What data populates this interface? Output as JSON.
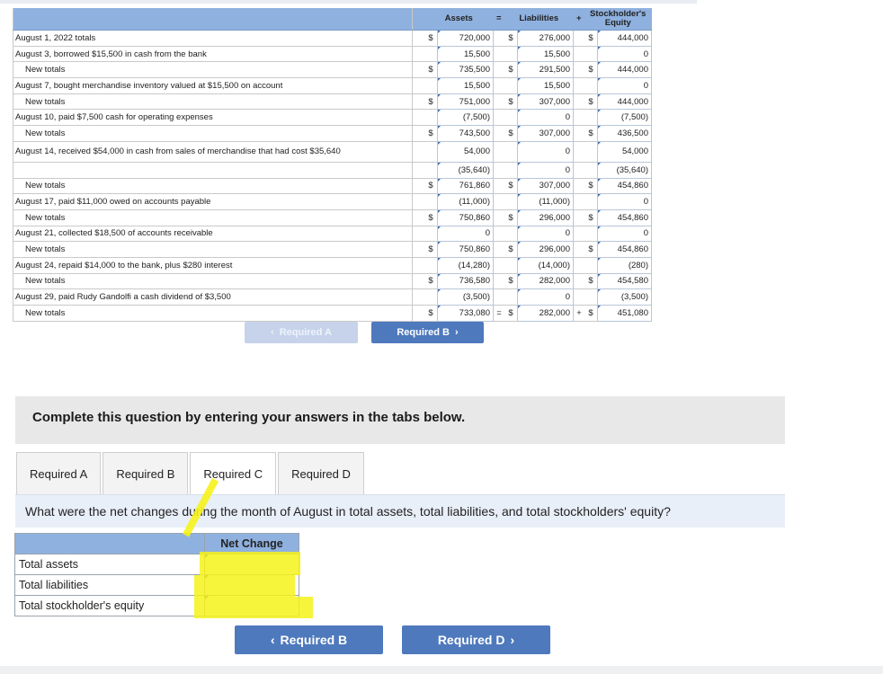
{
  "table": {
    "header": {
      "assets": "Assets",
      "eq": "=",
      "liabilities": "Liabilities",
      "plus": "+",
      "equity_line1": "Stockholder's",
      "equity_line2": "Equity"
    },
    "rows": [
      {
        "desc": "August 1, 2022 totals",
        "indent": false,
        "cur": true,
        "a": "720,000",
        "l": "276,000",
        "e": "444,000"
      },
      {
        "desc": "August 3, borrowed $15,500 in cash from the bank",
        "indent": false,
        "cur": false,
        "a": "15,500",
        "l": "15,500",
        "e": "0"
      },
      {
        "desc": "New totals",
        "indent": true,
        "cur": true,
        "a": "735,500",
        "l": "291,500",
        "e": "444,000"
      },
      {
        "desc": "August 7, bought merchandise inventory valued at $15,500 on account",
        "indent": false,
        "cur": false,
        "a": "15,500",
        "l": "15,500",
        "e": "0"
      },
      {
        "desc": "New totals",
        "indent": true,
        "cur": true,
        "a": "751,000",
        "l": "307,000",
        "e": "444,000"
      },
      {
        "desc": "August 10, paid $7,500 cash for operating expenses",
        "indent": false,
        "cur": false,
        "a": "(7,500)",
        "l": "0",
        "e": "(7,500)"
      },
      {
        "desc": "New totals",
        "indent": true,
        "cur": true,
        "a": "743,500",
        "l": "307,000",
        "e": "436,500"
      },
      {
        "desc": "August 14, received $54,000 in cash from sales of merchandise that had cost $35,640",
        "indent": false,
        "cur": false,
        "a": "54,000",
        "l": "0",
        "e": "54,000"
      },
      {
        "desc": "",
        "indent": false,
        "cur": false,
        "a": "(35,640)",
        "l": "0",
        "e": "(35,640)"
      },
      {
        "desc": "New totals",
        "indent": true,
        "cur": true,
        "a": "761,860",
        "l": "307,000",
        "e": "454,860"
      },
      {
        "desc": "August 17, paid $11,000 owed on accounts payable",
        "indent": false,
        "cur": false,
        "a": "(11,000)",
        "l": "(11,000)",
        "e": "0"
      },
      {
        "desc": "New totals",
        "indent": true,
        "cur": true,
        "a": "750,860",
        "l": "296,000",
        "e": "454,860"
      },
      {
        "desc": "August 21, collected $18,500 of accounts receivable",
        "indent": false,
        "cur": false,
        "a": "0",
        "l": "0",
        "e": "0"
      },
      {
        "desc": "New totals",
        "indent": true,
        "cur": true,
        "a": "750,860",
        "l": "296,000",
        "e": "454,860"
      },
      {
        "desc": "August 24, repaid $14,000 to the bank, plus $280 interest",
        "indent": false,
        "cur": false,
        "a": "(14,280)",
        "l": "(14,000)",
        "e": "(280)"
      },
      {
        "desc": "New totals",
        "indent": true,
        "cur": true,
        "a": "736,580",
        "l": "282,000",
        "e": "454,580"
      },
      {
        "desc": "August 29, paid Rudy Gandolfi a cash dividend of $3,500",
        "indent": false,
        "cur": false,
        "a": "(3,500)",
        "l": "0",
        "e": "(3,500)"
      },
      {
        "desc": "New totals",
        "indent": true,
        "cur": true,
        "a": "733,080",
        "l": "282,000",
        "e": "451,080",
        "ops": true
      }
    ]
  },
  "currency": "$",
  "nav_top": {
    "prev": "Required A",
    "next": "Required B"
  },
  "instructions": "Complete this question by entering your answers in the tabs below.",
  "tabs": [
    "Required A",
    "Required B",
    "Required C",
    "Required D"
  ],
  "active_tab": "Required C",
  "question": "What were the net changes during the month of August in total assets, total liabilities, and total stockholders' equity?",
  "answer_table": {
    "header": "Net Change",
    "rows": [
      "Total assets",
      "Total liabilities",
      "Total stockholder's equity"
    ]
  },
  "nav_bottom": {
    "prev": "Required B",
    "next": "Required D"
  },
  "icons": {
    "prev": "chevron-left-icon",
    "next": "chevron-right-icon"
  },
  "colors": {
    "header_blue": "#8fb1df",
    "button_blue": "#4e79bd",
    "highlight": "#f6f21a"
  }
}
